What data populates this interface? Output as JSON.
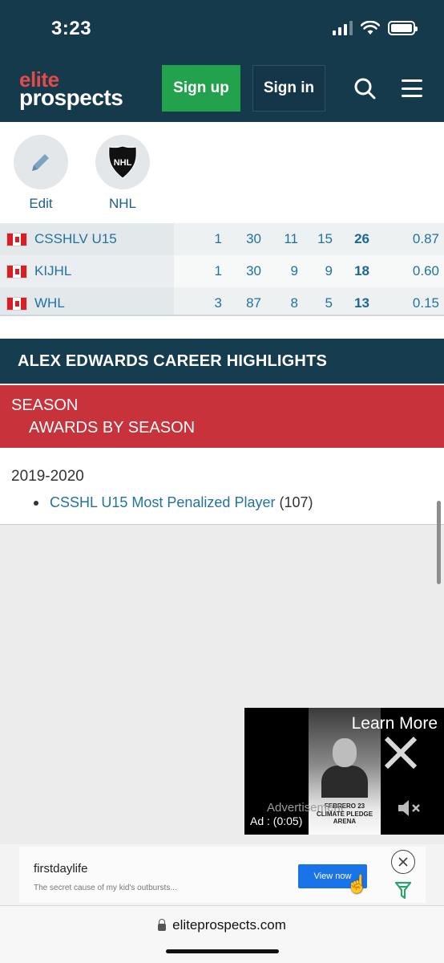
{
  "status_bar": {
    "time": "3:23"
  },
  "header": {
    "logo_line1": "elite",
    "logo_line2": "prospects",
    "signup_label": "Sign up",
    "signin_label": "Sign in",
    "icons": [
      "search-icon",
      "hamburger-menu-icon"
    ]
  },
  "actions": [
    {
      "label": "Edit",
      "icon": "pencil-icon"
    },
    {
      "label": "NHL",
      "icon": "nhl-logo-icon"
    }
  ],
  "stats_rows": [
    {
      "flag": "canada-flag",
      "league": "CSSHLV U15",
      "gp": "1",
      "g": "30",
      "a": "11",
      "tp": "15",
      "pts": "26",
      "ppg": "0.87"
    },
    {
      "flag": "canada-flag",
      "league": "KIJHL",
      "gp": "1",
      "g": "30",
      "a": "9",
      "tp": "9",
      "pts": "18",
      "ppg": "0.60"
    },
    {
      "flag": "canada-flag",
      "league": "WHL",
      "gp": "3",
      "g": "87",
      "a": "8",
      "tp": "5",
      "pts": "13",
      "ppg": "0.15"
    }
  ],
  "career_highlights": {
    "title": "ALEX EDWARDS CAREER HIGHLIGHTS",
    "season_label": "SEASON",
    "awards_label": "AWARDS BY SEASON",
    "awards": [
      {
        "season": "2019-2020",
        "award": "CSSHL U15 Most Penalized Player",
        "count": "(107)"
      }
    ]
  },
  "video_ad": {
    "learn_more": "Learn More",
    "advertisement_label": "Advertisement",
    "timer": "Ad : (0:05)",
    "poster_text": "FEBRERO 23 CLIMATE PLEDGE ARENA"
  },
  "banner_ad": {
    "brand": "firstdaylife",
    "tagline": "The secret cause of my kid's outbursts...",
    "cta": "View now"
  },
  "browser": {
    "url": "eliteprospects.com"
  },
  "colors": {
    "header_bg": "#153a4b",
    "signup_green": "#23a24d",
    "logo_red": "#e34a4a",
    "link_blue": "#2372a0",
    "season_red": "#c8323b"
  }
}
